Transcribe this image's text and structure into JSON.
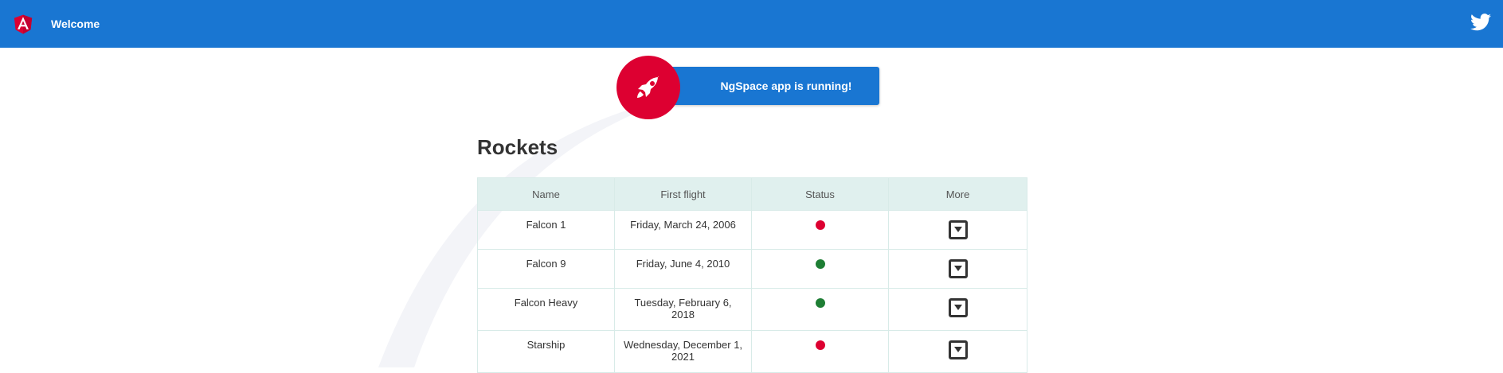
{
  "header": {
    "title": "Welcome",
    "logo_icon": "angular-logo-icon",
    "social_icon": "twitter-icon",
    "bg_color": "#1976d2"
  },
  "banner": {
    "text": "NgSpace app is running!",
    "icon": "rocket-icon",
    "icon_bg": "#dd0031"
  },
  "rockets": {
    "heading": "Rockets",
    "columns": [
      "Name",
      "First flight",
      "Status",
      "More"
    ],
    "rows": [
      {
        "name": "Falcon 1",
        "first_flight": "Friday, March 24, 2006",
        "status": "failed",
        "status_color": "#dd0031"
      },
      {
        "name": "Falcon 9",
        "first_flight": "Friday, June 4, 2010",
        "status": "success",
        "status_color": "#1e7e34"
      },
      {
        "name": "Falcon Heavy",
        "first_flight": "Tuesday, February 6, 2018",
        "status": "success",
        "status_color": "#1e7e34"
      },
      {
        "name": "Starship",
        "first_flight": "Wednesday, December 1, 2021",
        "status": "failed",
        "status_color": "#dd0031"
      }
    ],
    "more_icon": "expand-down-icon"
  }
}
